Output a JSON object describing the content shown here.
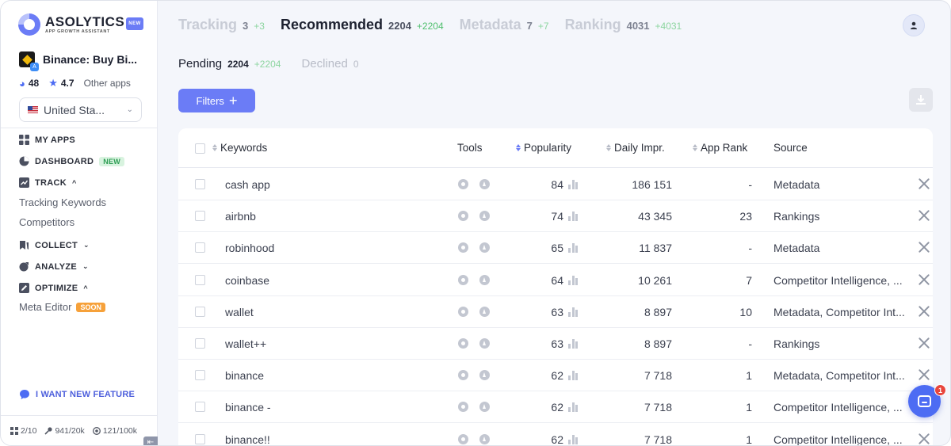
{
  "brand": {
    "name": "ASOLYTICS",
    "tagline": "APP GROWTH ASSISTANT",
    "badge": "NEW"
  },
  "app": {
    "name": "Binance: Buy Bi...",
    "rating_count": "48",
    "rating": "4.7",
    "other_apps": "Other apps",
    "country": "United Sta..."
  },
  "nav": {
    "my_apps": "MY APPS",
    "dashboard": "DASHBOARD",
    "dashboard_badge": "NEW",
    "track": "TRACK",
    "tracking_keywords": "Tracking Keywords",
    "competitors": "Competitors",
    "collect": "COLLECT",
    "analyze": "ANALYZE",
    "optimize": "OPTIMIZE",
    "meta_editor": "Meta Editor",
    "meta_editor_badge": "SOON",
    "feature_request": "I WANT NEW FEATURE"
  },
  "limits": {
    "apps": "2/10",
    "keywords": "941/20k",
    "requests": "121/100k"
  },
  "tabs": [
    {
      "label": "Tracking",
      "count": "3",
      "delta": "+3"
    },
    {
      "label": "Recommended",
      "count": "2204",
      "delta": "+2204"
    },
    {
      "label": "Metadata",
      "count": "7",
      "delta": "+7"
    },
    {
      "label": "Ranking",
      "count": "4031",
      "delta": "+4031"
    }
  ],
  "subtabs": [
    {
      "label": "Pending",
      "count": "2204",
      "delta": "+2204"
    },
    {
      "label": "Declined",
      "count": "0"
    }
  ],
  "toolbar": {
    "filters_label": "Filters"
  },
  "table": {
    "headers": {
      "keywords": "Keywords",
      "tools": "Tools",
      "popularity": "Popularity",
      "daily": "Daily Impr.",
      "rank": "App Rank",
      "source": "Source"
    },
    "rows": [
      {
        "keyword": "cash app",
        "popularity": "84",
        "daily": "186 151",
        "rank": "-",
        "source": "Metadata"
      },
      {
        "keyword": "airbnb",
        "popularity": "74",
        "daily": "43 345",
        "rank": "23",
        "source": "Rankings"
      },
      {
        "keyword": "robinhood",
        "popularity": "65",
        "daily": "11 837",
        "rank": "-",
        "source": "Metadata"
      },
      {
        "keyword": "coinbase",
        "popularity": "64",
        "daily": "10 261",
        "rank": "7",
        "source": "Competitor Intelligence, ..."
      },
      {
        "keyword": "wallet",
        "popularity": "63",
        "daily": "8 897",
        "rank": "10",
        "source": "Metadata, Competitor Int..."
      },
      {
        "keyword": "wallet++",
        "popularity": "63",
        "daily": "8 897",
        "rank": "-",
        "source": "Rankings"
      },
      {
        "keyword": "binance",
        "popularity": "62",
        "daily": "7 718",
        "rank": "1",
        "source": "Metadata, Competitor Int..."
      },
      {
        "keyword": "binance -",
        "popularity": "62",
        "daily": "7 718",
        "rank": "1",
        "source": "Competitor Intelligence, ..."
      },
      {
        "keyword": "binance!!",
        "popularity": "62",
        "daily": "7 718",
        "rank": "1",
        "source": "Competitor Intelligence, ..."
      }
    ]
  },
  "chat": {
    "unread": "1"
  },
  "colors": {
    "accent": "#6b7cf6",
    "delta": "#4fbf6d",
    "notification": "#e8453c"
  }
}
